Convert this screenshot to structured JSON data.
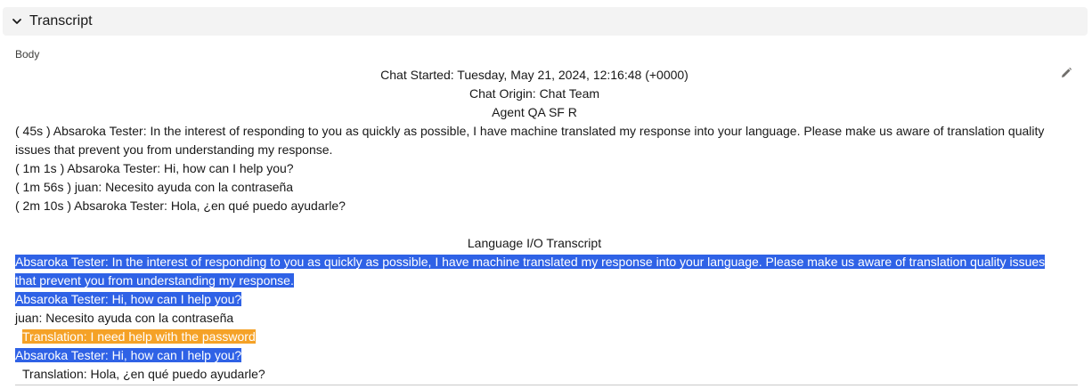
{
  "section": {
    "title": "Transcript",
    "chevron_icon": "chevron-down-icon"
  },
  "field": {
    "label": "Body",
    "edit_icon": "pencil-icon"
  },
  "transcript": {
    "chat_started": "Chat Started: Tuesday, May 21, 2024, 12:16:48 (+0000)",
    "chat_origin": "Chat Origin: Chat Team",
    "agent": "Agent QA SF R",
    "messages": [
      "( 45s ) Absaroka Tester: In the interest of responding to you as quickly as possible, I have machine translated my response into your language. Please make us aware of translation quality issues that prevent you from understanding my response.",
      "( 1m 1s ) Absaroka Tester: Hi, how can I help you?",
      "( 1m 56s ) juan: Necesito ayuda con la contraseña",
      "( 2m 10s ) Absaroka Tester: Hola, ¿en qué puedo ayudarle?"
    ]
  },
  "language_io": {
    "heading": "Language I/O Transcript",
    "line_1": "Absaroka Tester: In the interest of responding to you as quickly as possible, I have machine translated my response into your language. Please make us aware of translation quality issues that prevent you from understanding my response.",
    "line_2": "Absaroka Tester: Hi, how can I help you?",
    "line_3": "juan: Necesito ayuda con la contraseña",
    "line_4": "Translation: I need help with the password",
    "line_5": "Absaroka Tester: Hi, how can I help you?",
    "line_6": "Translation: Hola, ¿en qué puedo ayudarle?"
  },
  "colors": {
    "agent_highlight": "#2f62e6",
    "translation_highlight": "#f5a227",
    "header_background": "#f3f3f3"
  }
}
